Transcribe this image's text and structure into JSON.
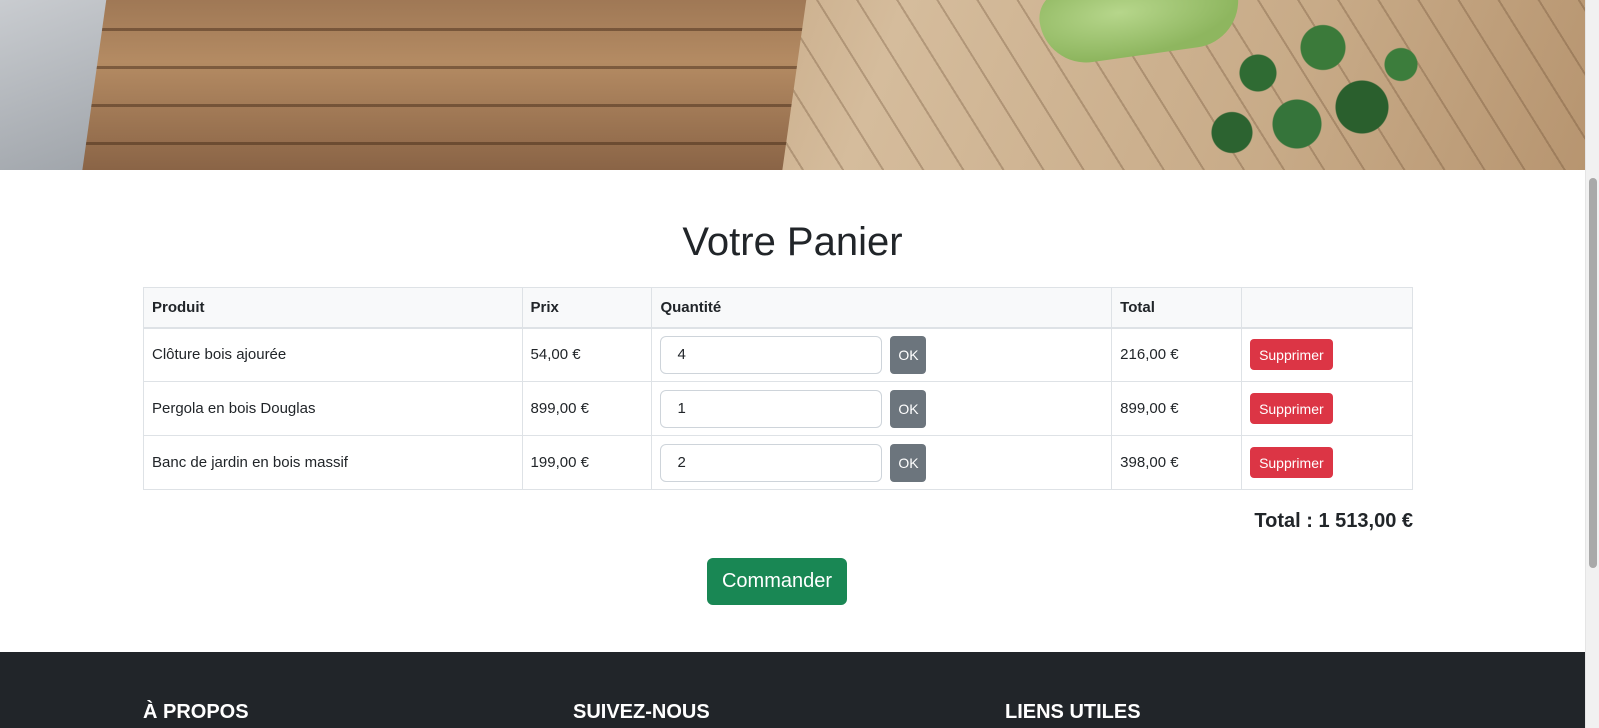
{
  "page": {
    "title": "Votre Panier"
  },
  "cart": {
    "headers": {
      "product": "Produit",
      "price": "Prix",
      "quantity": "Quantité",
      "total": "Total",
      "actions": ""
    },
    "rows": [
      {
        "product": "Clôture bois ajourée",
        "price": "54,00 €",
        "quantity": "4",
        "ok_label": "OK",
        "total": "216,00 €",
        "delete_label": "Supprimer"
      },
      {
        "product": "Pergola en bois Douglas",
        "price": "899,00 €",
        "quantity": "1",
        "ok_label": "OK",
        "total": "899,00 €",
        "delete_label": "Supprimer"
      },
      {
        "product": "Banc de jardin en bois massif",
        "price": "199,00 €",
        "quantity": "2",
        "ok_label": "OK",
        "total": "398,00 €",
        "delete_label": "Supprimer"
      }
    ],
    "grand_total": "Total : 1 513,00 €",
    "order_button": "Commander"
  },
  "footer": {
    "sections": [
      "À PROPOS",
      "SUIVEZ-NOUS",
      "LIENS UTILES"
    ]
  },
  "colors": {
    "danger": "#dc3545",
    "secondary": "#6c757d",
    "success": "#198754",
    "footer_bg": "#212529"
  }
}
